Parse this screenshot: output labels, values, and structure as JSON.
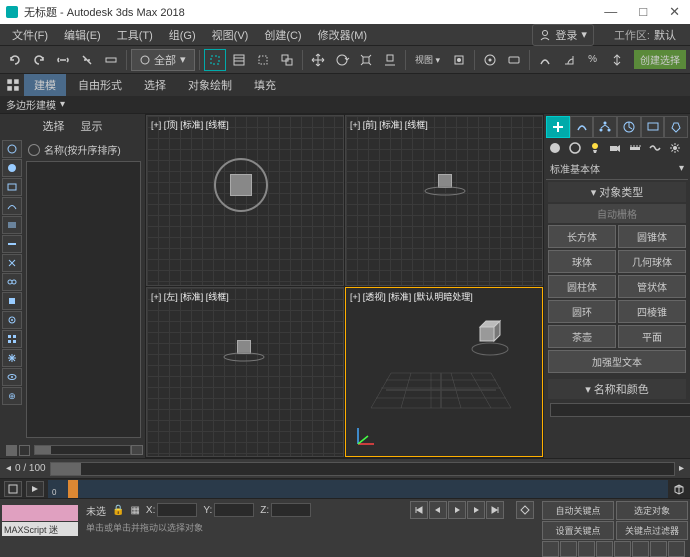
{
  "titlebar": {
    "icon": "3dsmax-icon",
    "title": "无标题 - Autodesk 3ds Max 2018"
  },
  "winctrl": {
    "min": "—",
    "max": "□",
    "close": "✕"
  },
  "menu": {
    "file": "文件(F)",
    "edit": "编辑(E)",
    "tool": "工具(T)",
    "group": "组(G)",
    "view": "视图(V)",
    "create": "创建(C)",
    "modifier": "修改器(M)",
    "login": "登录",
    "workspace_label": "工作区:",
    "workspace_val": "默认"
  },
  "toolbar": {
    "all": "全部"
  },
  "ribbon_right": "创建选择",
  "ribbon": {
    "model": "建模",
    "freeform": "自由形式",
    "select": "选择",
    "objpaint": "对象绘制",
    "fill": "填充"
  },
  "polymodel": "多边形建模",
  "leftpanel": {
    "select": "选择",
    "display": "显示",
    "name_sort": "名称(按升序排序)"
  },
  "viewports": {
    "top": "[+] [顶] [标准] [线框]",
    "front": "[+] [前] [标准] [线框]",
    "left": "[+] [左] [标准] [线框]",
    "persp": "[+] [透视] [标准] [默认明暗处理]"
  },
  "rightpanel": {
    "primitive_title": "标准基本体",
    "object_type": "对象类型",
    "auto_grid": "自动栅格",
    "buttons": {
      "box": "长方体",
      "cone": "圆锥体",
      "sphere": "球体",
      "geosphere": "几何球体",
      "cylinder": "圆柱体",
      "tube": "管状体",
      "torus": "圆环",
      "pyramid": "四棱锥",
      "teapot": "茶壶",
      "plane": "平面",
      "textplus": "加强型文本"
    },
    "name_color": "名称和颜色"
  },
  "timebar": {
    "range": "0 / 100"
  },
  "timeline": {
    "start": "0"
  },
  "status": {
    "script": "MAXScript 迷",
    "untitled": "未选",
    "x": "X:",
    "y": "Y:",
    "z": "Z:",
    "autokey": "自动关键点",
    "selected": "选定对象",
    "setkey": "设置关键点",
    "keyfilter": "关键点过滤器",
    "hint": "单击或单击并拖动以选择对象"
  }
}
